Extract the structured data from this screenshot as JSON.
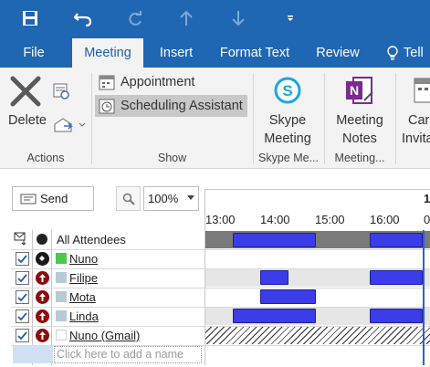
{
  "quick_access": {
    "save_icon": "save-icon",
    "undo_icon": "undo-icon",
    "redo_icon": "redo-icon",
    "up_icon": "arrow-up-icon",
    "down_icon": "arrow-down-icon",
    "customize_icon": "customize-qat-icon"
  },
  "tabs": [
    {
      "label": "File"
    },
    {
      "label": "Meeting"
    },
    {
      "label": "Insert"
    },
    {
      "label": "Format Text"
    },
    {
      "label": "Review"
    },
    {
      "label": "Tell"
    }
  ],
  "ribbon": {
    "actions": {
      "delete_label": "Delete",
      "group_label": "Actions"
    },
    "show": {
      "appointment_label": "Appointment",
      "scheduling_label": "Scheduling Assistant",
      "group_label": "Show"
    },
    "skype": {
      "line1": "Skype",
      "line2": "Meeting",
      "group_label": "Skype Me..."
    },
    "notes": {
      "line1": "Meeting",
      "line2": "Notes",
      "group_label": "Meeting..."
    },
    "invite": {
      "line1": "Car",
      "line2": "Invita"
    }
  },
  "scheduling": {
    "send_label": "Send",
    "zoom_value": "100%",
    "day_label": "1",
    "hours": [
      "13:00",
      "14:00",
      "15:00",
      "16:00",
      "0"
    ],
    "all_attendees_label": "All Attendees",
    "attendees": [
      {
        "name": "Nuno",
        "role": "organizer",
        "swatch": "#4cc84c"
      },
      {
        "name": "Filipe",
        "role": "required",
        "swatch": "#b7cbd6"
      },
      {
        "name": "Mota",
        "role": "required",
        "swatch": "#b7cbd6"
      },
      {
        "name": "Linda",
        "role": "required",
        "swatch": "#b7cbd6"
      },
      {
        "name": "Nuno (Gmail)",
        "role": "required",
        "swatch": "#ffffff"
      }
    ],
    "add_name_placeholder": "Click here to add a name"
  },
  "colors": {
    "title_bar": "#1f66b3",
    "busy": "#3b3de8",
    "organizer_swatch": "#4cc84c"
  }
}
